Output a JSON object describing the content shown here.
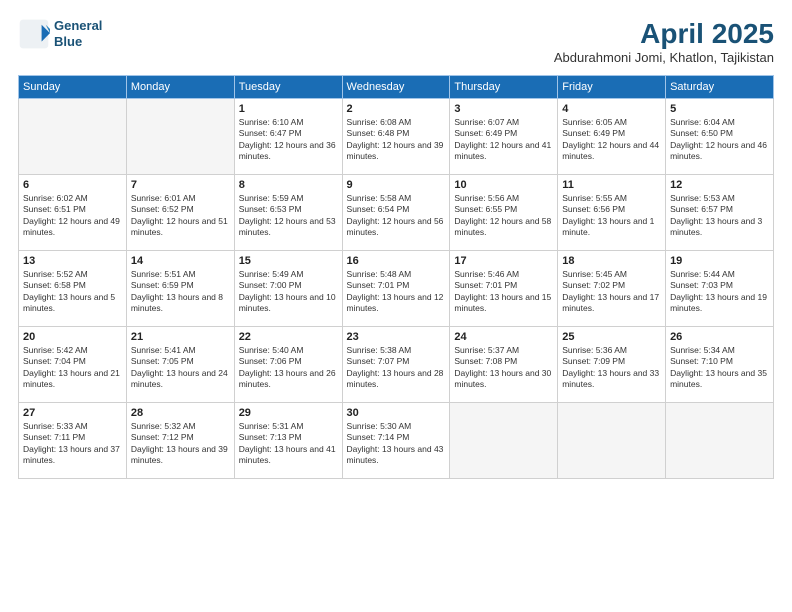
{
  "header": {
    "logo_line1": "General",
    "logo_line2": "Blue",
    "title": "April 2025",
    "subtitle": "Abdurahmoni Jomi, Khatlon, Tajikistan"
  },
  "days_of_week": [
    "Sunday",
    "Monday",
    "Tuesday",
    "Wednesday",
    "Thursday",
    "Friday",
    "Saturday"
  ],
  "weeks": [
    [
      {
        "day": "",
        "empty": true
      },
      {
        "day": "",
        "empty": true
      },
      {
        "day": "1",
        "sunrise": "6:10 AM",
        "sunset": "6:47 PM",
        "daylight": "12 hours and 36 minutes."
      },
      {
        "day": "2",
        "sunrise": "6:08 AM",
        "sunset": "6:48 PM",
        "daylight": "12 hours and 39 minutes."
      },
      {
        "day": "3",
        "sunrise": "6:07 AM",
        "sunset": "6:49 PM",
        "daylight": "12 hours and 41 minutes."
      },
      {
        "day": "4",
        "sunrise": "6:05 AM",
        "sunset": "6:49 PM",
        "daylight": "12 hours and 44 minutes."
      },
      {
        "day": "5",
        "sunrise": "6:04 AM",
        "sunset": "6:50 PM",
        "daylight": "12 hours and 46 minutes."
      }
    ],
    [
      {
        "day": "6",
        "sunrise": "6:02 AM",
        "sunset": "6:51 PM",
        "daylight": "12 hours and 49 minutes."
      },
      {
        "day": "7",
        "sunrise": "6:01 AM",
        "sunset": "6:52 PM",
        "daylight": "12 hours and 51 minutes."
      },
      {
        "day": "8",
        "sunrise": "5:59 AM",
        "sunset": "6:53 PM",
        "daylight": "12 hours and 53 minutes."
      },
      {
        "day": "9",
        "sunrise": "5:58 AM",
        "sunset": "6:54 PM",
        "daylight": "12 hours and 56 minutes."
      },
      {
        "day": "10",
        "sunrise": "5:56 AM",
        "sunset": "6:55 PM",
        "daylight": "12 hours and 58 minutes."
      },
      {
        "day": "11",
        "sunrise": "5:55 AM",
        "sunset": "6:56 PM",
        "daylight": "13 hours and 1 minute."
      },
      {
        "day": "12",
        "sunrise": "5:53 AM",
        "sunset": "6:57 PM",
        "daylight": "13 hours and 3 minutes."
      }
    ],
    [
      {
        "day": "13",
        "sunrise": "5:52 AM",
        "sunset": "6:58 PM",
        "daylight": "13 hours and 5 minutes."
      },
      {
        "day": "14",
        "sunrise": "5:51 AM",
        "sunset": "6:59 PM",
        "daylight": "13 hours and 8 minutes."
      },
      {
        "day": "15",
        "sunrise": "5:49 AM",
        "sunset": "7:00 PM",
        "daylight": "13 hours and 10 minutes."
      },
      {
        "day": "16",
        "sunrise": "5:48 AM",
        "sunset": "7:01 PM",
        "daylight": "13 hours and 12 minutes."
      },
      {
        "day": "17",
        "sunrise": "5:46 AM",
        "sunset": "7:01 PM",
        "daylight": "13 hours and 15 minutes."
      },
      {
        "day": "18",
        "sunrise": "5:45 AM",
        "sunset": "7:02 PM",
        "daylight": "13 hours and 17 minutes."
      },
      {
        "day": "19",
        "sunrise": "5:44 AM",
        "sunset": "7:03 PM",
        "daylight": "13 hours and 19 minutes."
      }
    ],
    [
      {
        "day": "20",
        "sunrise": "5:42 AM",
        "sunset": "7:04 PM",
        "daylight": "13 hours and 21 minutes."
      },
      {
        "day": "21",
        "sunrise": "5:41 AM",
        "sunset": "7:05 PM",
        "daylight": "13 hours and 24 minutes."
      },
      {
        "day": "22",
        "sunrise": "5:40 AM",
        "sunset": "7:06 PM",
        "daylight": "13 hours and 26 minutes."
      },
      {
        "day": "23",
        "sunrise": "5:38 AM",
        "sunset": "7:07 PM",
        "daylight": "13 hours and 28 minutes."
      },
      {
        "day": "24",
        "sunrise": "5:37 AM",
        "sunset": "7:08 PM",
        "daylight": "13 hours and 30 minutes."
      },
      {
        "day": "25",
        "sunrise": "5:36 AM",
        "sunset": "7:09 PM",
        "daylight": "13 hours and 33 minutes."
      },
      {
        "day": "26",
        "sunrise": "5:34 AM",
        "sunset": "7:10 PM",
        "daylight": "13 hours and 35 minutes."
      }
    ],
    [
      {
        "day": "27",
        "sunrise": "5:33 AM",
        "sunset": "7:11 PM",
        "daylight": "13 hours and 37 minutes."
      },
      {
        "day": "28",
        "sunrise": "5:32 AM",
        "sunset": "7:12 PM",
        "daylight": "13 hours and 39 minutes."
      },
      {
        "day": "29",
        "sunrise": "5:31 AM",
        "sunset": "7:13 PM",
        "daylight": "13 hours and 41 minutes."
      },
      {
        "day": "30",
        "sunrise": "5:30 AM",
        "sunset": "7:14 PM",
        "daylight": "13 hours and 43 minutes."
      },
      {
        "day": "",
        "empty": true
      },
      {
        "day": "",
        "empty": true
      },
      {
        "day": "",
        "empty": true
      }
    ]
  ],
  "labels": {
    "sunrise": "Sunrise:",
    "sunset": "Sunset:",
    "daylight": "Daylight:"
  }
}
